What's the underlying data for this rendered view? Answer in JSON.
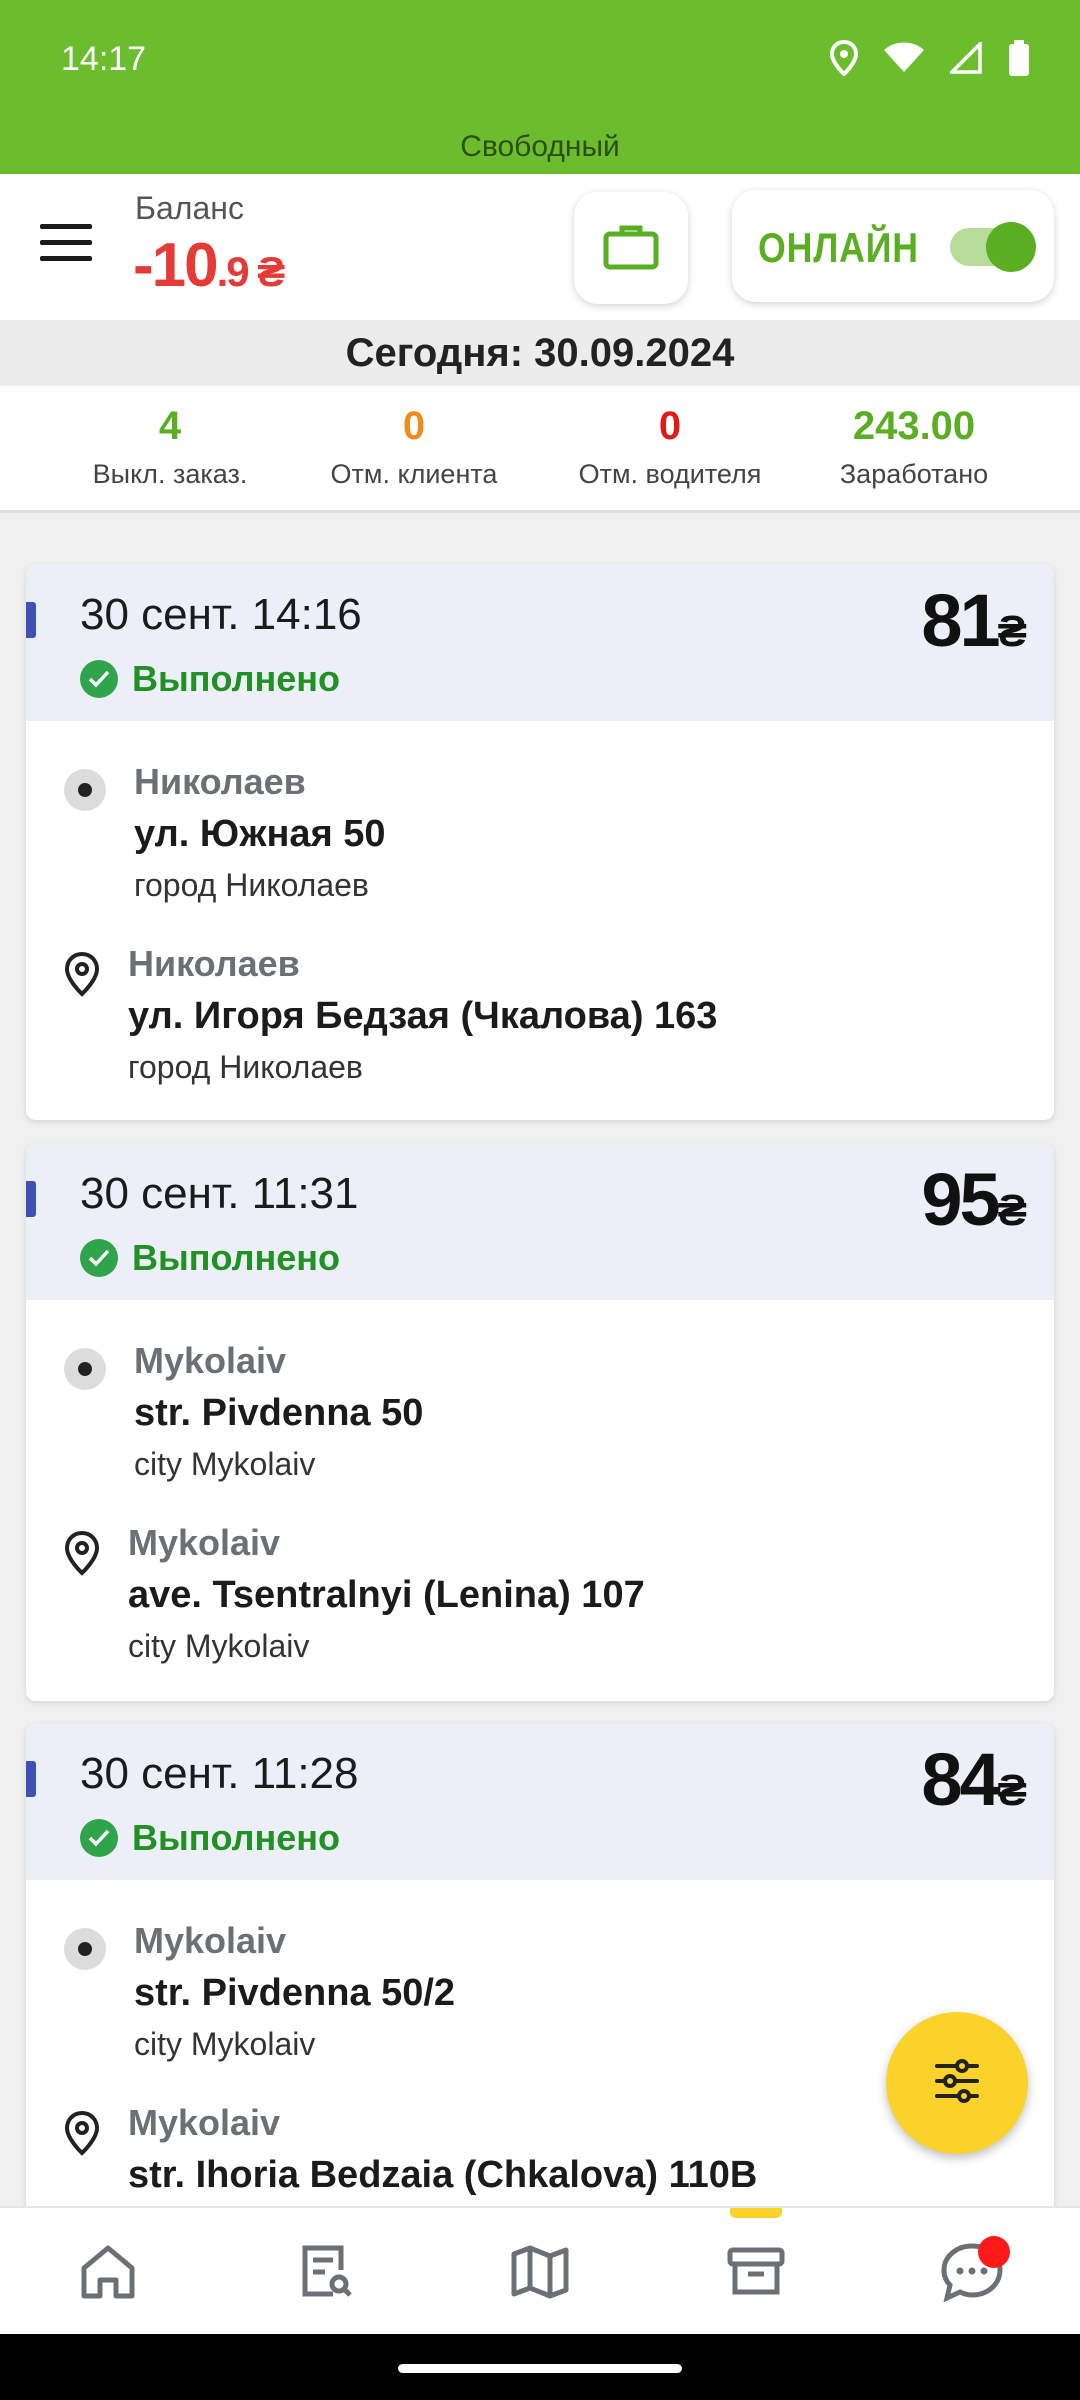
{
  "status_bar": {
    "time": "14:17",
    "icons": [
      "location-icon",
      "wifi-icon",
      "signal-icon",
      "battery-icon"
    ]
  },
  "driver_status": "Свободный",
  "header": {
    "balance_label": "Баланс",
    "balance_main": "-10",
    "balance_fraction": ".9 ₴",
    "online_label": "ОНЛАЙН",
    "online_enabled": true
  },
  "date_bar": "Сегодня: 30.09.2024",
  "stats": [
    {
      "value": "4",
      "label": "Выкл. заказ.",
      "color": "#5aae22"
    },
    {
      "value": "0",
      "label": "Отм. клиента",
      "color": "#f08c1e"
    },
    {
      "value": "0",
      "label": "Отм. водителя",
      "color": "#e01a1a"
    },
    {
      "value": "243.00",
      "label": "Заработано",
      "color": "#5aae22"
    }
  ],
  "orders": [
    {
      "time": "30 сент. 14:16",
      "status": "Выполнено",
      "price": "81",
      "currency": "₴",
      "from": {
        "city": "Николаев",
        "street": "ул. Южная 50",
        "sub": "город Николаев"
      },
      "to": {
        "city": "Николаев",
        "street": "ул. Игоря Бедзая (Чкалова) 163",
        "sub": "город Николаев"
      }
    },
    {
      "time": "30 сент. 11:31",
      "status": "Выполнено",
      "price": "95",
      "currency": "₴",
      "from": {
        "city": "Mykolaiv",
        "street": "str. Pivdenna 50",
        "sub": "city Mykolaiv"
      },
      "to": {
        "city": "Mykolaiv",
        "street": "ave. Tsentralnyi (Lenina) 107",
        "sub": "city Mykolaiv"
      }
    },
    {
      "time": "30 сент. 11:28",
      "status": "Выполнено",
      "price": "84",
      "currency": "₴",
      "from": {
        "city": "Mykolaiv",
        "street": "str. Pivdenna 50/2",
        "sub": "city Mykolaiv"
      },
      "to": {
        "city": "Mykolaiv",
        "street": "str. Ihoria Bedzaia (Chkalova) 110B",
        "sub": ""
      }
    }
  ],
  "bottom_nav": [
    "home-icon",
    "order-search-icon",
    "map-icon",
    "archive-icon",
    "chat-icon"
  ],
  "colors": {
    "brand_green": "#6cbd2e",
    "accent_yellow": "#fbd22a",
    "balance_red": "#e53b36",
    "done_green": "#219124"
  }
}
